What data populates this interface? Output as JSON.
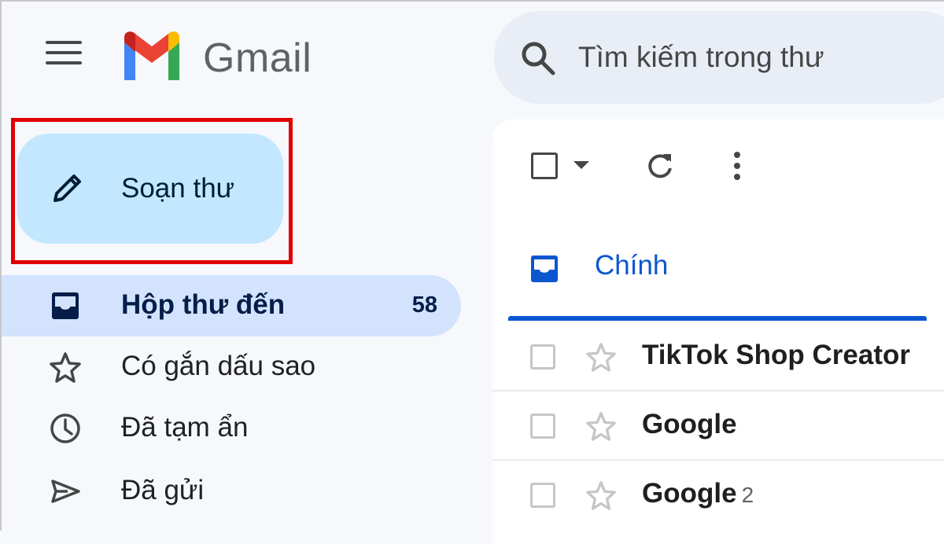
{
  "header": {
    "brand": "Gmail",
    "search_placeholder": "Tìm kiếm trong thư"
  },
  "sidebar": {
    "compose_label": "Soạn thư",
    "items": [
      {
        "label": "Hộp thư đến",
        "count": "58",
        "icon": "inbox-icon",
        "active": true
      },
      {
        "label": "Có gắn dấu sao",
        "icon": "star-icon"
      },
      {
        "label": "Đã tạm ẩn",
        "icon": "clock-icon"
      },
      {
        "label": "Đã gửi",
        "icon": "send-icon"
      }
    ]
  },
  "main": {
    "tabs": [
      {
        "label": "Chính",
        "icon": "inbox-icon",
        "active": true
      }
    ],
    "emails": [
      {
        "sender": "TikTok Shop Creator",
        "thread_count": ""
      },
      {
        "sender": "Google",
        "thread_count": ""
      },
      {
        "sender": "Google",
        "thread_count": "2"
      }
    ]
  },
  "colors": {
    "accent": "#0b57d0",
    "compose_bg": "#c2e7ff",
    "active_nav_bg": "#d3e3fd",
    "highlight_border": "#e00000",
    "page_bg": "#f6f8fc"
  }
}
